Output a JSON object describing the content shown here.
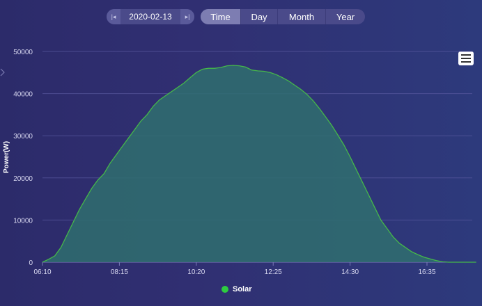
{
  "date_nav": {
    "date": "2020-02-13",
    "prev_icon": "prev-day-icon",
    "next_icon": "next-day-icon"
  },
  "period_tabs": [
    {
      "label": "Time",
      "active": true
    },
    {
      "label": "Day",
      "active": false
    },
    {
      "label": "Month",
      "active": false
    },
    {
      "label": "Year",
      "active": false
    }
  ],
  "menu_icon": "hamburger-menu-icon",
  "colors": {
    "series_line": "#46b84a",
    "series_fill": "#2f6e6e",
    "legend_dot": "#2ecc40",
    "grid": "#5a5aa0"
  },
  "chart_data": {
    "type": "area",
    "title": "",
    "xlabel": "",
    "ylabel": "Power(W)",
    "ylim": [
      0,
      50000
    ],
    "yticks": [
      0,
      10000,
      20000,
      30000,
      40000,
      50000
    ],
    "xticks": [
      "06:10",
      "08:15",
      "10:20",
      "12:25",
      "14:30",
      "16:35"
    ],
    "xlim": [
      "06:10",
      "17:55"
    ],
    "grid": true,
    "legend_position": "bottom",
    "series": [
      {
        "name": "Solar",
        "x": [
          "06:10",
          "06:20",
          "06:30",
          "06:40",
          "06:50",
          "07:00",
          "07:10",
          "07:20",
          "07:30",
          "07:40",
          "07:50",
          "08:00",
          "08:10",
          "08:20",
          "08:30",
          "08:40",
          "08:50",
          "09:00",
          "09:10",
          "09:20",
          "09:30",
          "09:40",
          "09:50",
          "10:00",
          "10:10",
          "10:20",
          "10:30",
          "10:40",
          "10:50",
          "11:00",
          "11:10",
          "11:20",
          "11:30",
          "11:40",
          "11:50",
          "12:00",
          "12:10",
          "12:20",
          "12:30",
          "12:40",
          "12:50",
          "13:00",
          "13:10",
          "13:20",
          "13:30",
          "13:40",
          "13:50",
          "14:00",
          "14:10",
          "14:20",
          "14:30",
          "14:40",
          "14:50",
          "15:00",
          "15:10",
          "15:20",
          "15:30",
          "15:40",
          "15:50",
          "16:00",
          "16:10",
          "16:20",
          "16:30",
          "16:40",
          "16:50",
          "17:00",
          "17:10",
          "17:20",
          "17:30",
          "17:40",
          "17:50",
          "17:55"
        ],
        "values": [
          0,
          700,
          1500,
          3500,
          6500,
          9500,
          12500,
          15000,
          17500,
          19500,
          21000,
          23500,
          25500,
          27500,
          29500,
          31500,
          33500,
          35000,
          37000,
          38500,
          39500,
          40500,
          41500,
          42500,
          43800,
          45000,
          45800,
          46000,
          46000,
          46200,
          46600,
          46700,
          46600,
          46300,
          45600,
          45400,
          45300,
          45000,
          44500,
          43800,
          43000,
          42000,
          41000,
          39800,
          38300,
          36500,
          34500,
          32500,
          30200,
          27800,
          25000,
          22000,
          19000,
          16000,
          13000,
          10000,
          8000,
          6000,
          4500,
          3500,
          2500,
          1800,
          1200,
          800,
          400,
          100,
          0,
          0,
          0,
          0,
          0,
          0
        ]
      }
    ]
  }
}
